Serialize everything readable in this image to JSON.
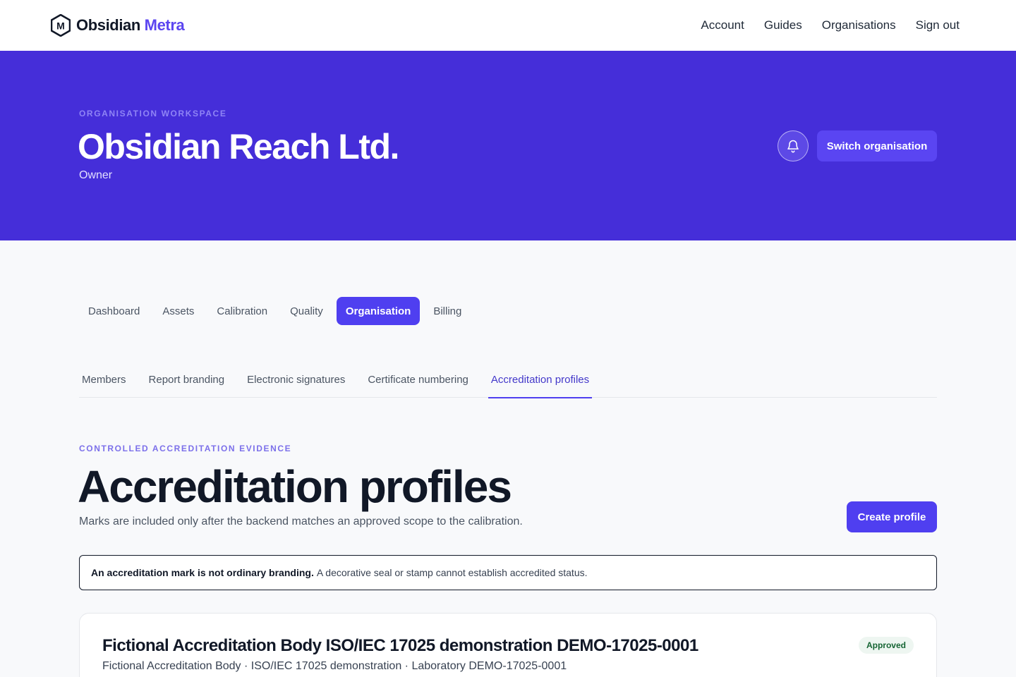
{
  "brand": {
    "name_primary": "Obsidian",
    "name_accent": "Metra",
    "logo_letter": "M"
  },
  "topnav": {
    "items": [
      "Account",
      "Guides",
      "Organisations",
      "Sign out"
    ]
  },
  "hero": {
    "eyebrow": "ORGANISATION WORKSPACE",
    "title": "Obsidian Reach Ltd.",
    "role": "Owner",
    "notifications_icon": "bell-icon",
    "switch_label": "Switch organisation"
  },
  "primary_tabs": {
    "items": [
      "Dashboard",
      "Assets",
      "Calibration",
      "Quality",
      "Organisation",
      "Billing"
    ],
    "active": "Organisation"
  },
  "secondary_tabs": {
    "items": [
      "Members",
      "Report branding",
      "Electronic signatures",
      "Certificate numbering",
      "Accreditation profiles"
    ],
    "active": "Accreditation profiles"
  },
  "section": {
    "eyebrow": "CONTROLLED ACCREDITATION EVIDENCE",
    "title": "Accreditation profiles",
    "description": "Marks are included only after the backend matches an approved scope to the calibration.",
    "create_label": "Create profile"
  },
  "notice": {
    "strong": "An accreditation mark is not ordinary branding.",
    "text": "A decorative seal or stamp cannot establish accredited status."
  },
  "profiles": [
    {
      "title": "Fictional Accreditation Body ISO/IEC 17025 demonstration DEMO-17025-0001",
      "subtitle": "Fictional Accreditation Body · ISO/IEC 17025 demonstration · Laboratory DEMO-17025-0001",
      "status": "Approved"
    }
  ],
  "colors": {
    "brand_accent": "#5b45f0",
    "hero_bg": "#452ed9",
    "primary_button": "#4f3ff0",
    "approved_badge_bg": "#eef6f1",
    "approved_badge_text": "#166534"
  }
}
